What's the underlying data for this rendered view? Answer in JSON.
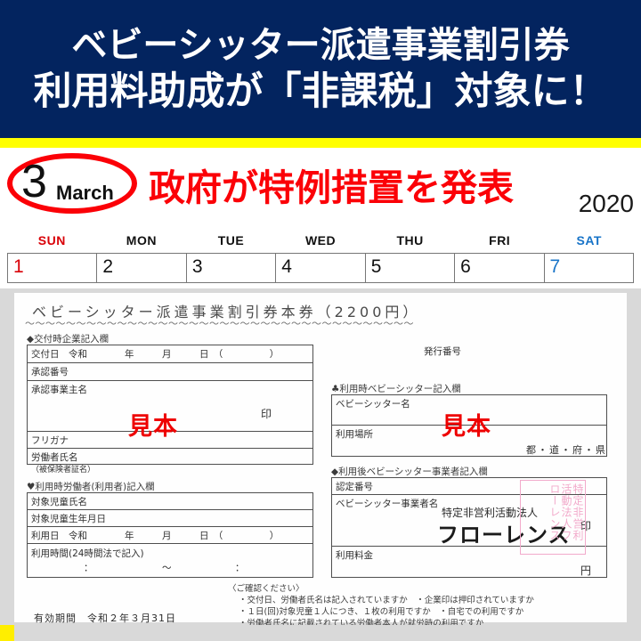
{
  "banner": {
    "line1": "ベビーシッター派遣事業割引券",
    "line2": "利用料助成が「非課税」対象に！",
    "bg_color": "#03245f",
    "text_color": "#ffffff",
    "accent_bar_color": "#ffff00"
  },
  "calendar": {
    "month_number": "3",
    "month_name": "March",
    "headline": "政府が特例措置を発表",
    "headline_color": "#fb0007",
    "year": "2020",
    "circle_color": "#fb0007",
    "weekdays": [
      "SUN",
      "MON",
      "TUE",
      "WED",
      "THU",
      "FRI",
      "SAT"
    ],
    "days": [
      "1",
      "2",
      "3",
      "4",
      "5",
      "6",
      "7"
    ],
    "sunday_color": "#d90007",
    "saturday_color": "#1874c8"
  },
  "coupon": {
    "title": "ベビーシッター派遣事業割引券本券（2200円）",
    "issue_number_label": "発行番号",
    "watermark": "見本",
    "watermark_color": "#ee0000",
    "section_company": {
      "label": "◆交付時企業記入欄",
      "row_issue_date": "交付日　令和　　　　年　　　月　　　日　（　　　　　）",
      "row_approval_number": "承認番号",
      "row_employer_name": "承認事業主名",
      "seal_mark": "印",
      "row_furigana": "フリガナ",
      "row_worker_name": "労働者氏名",
      "row_worker_name_sub": "（被保険者証名）"
    },
    "section_worker": {
      "label": "♥利用時労働者(利用者)記入欄",
      "row_child_name": "対象児童氏名",
      "row_child_birth": "対象児童生年月日",
      "row_use_date": "利用日　令和　　　　年　　　月　　　日　（　　　　　）",
      "row_use_time": "利用時間(24時間法で記入)",
      "time_from": "：",
      "time_sep": "～",
      "time_to": "："
    },
    "section_sitter": {
      "label": "♣利用時ベビーシッター記入欄",
      "row_sitter_name": "ベビーシッター名",
      "row_place": "利用場所",
      "prefecture": "都・道・府・県"
    },
    "section_provider": {
      "label": "◆利用後ベビーシッター事業者記入欄",
      "row_cert_number": "認定番号",
      "row_provider_name": "ベビーシッター事業者名",
      "org_prefix": "特定非営利活動法人",
      "org_name": "フローレンス",
      "seal_mark": "印",
      "stamp_text": "特定非営利活動法人フローレンス",
      "stamp_color": "#f2aacb",
      "row_fee": "利用料金",
      "fee_unit": "円"
    },
    "confirm": {
      "title": "〈ご確認ください〉",
      "line1": "・交付日、労働者氏名は記入されていますか　・企業印は押印されていますか",
      "line2": "・１日(回)対象児童１人につき、１枚の利用ですか　・自宅での利用ですか",
      "line3": "・労働者氏名に記載されている労働者本人が就労時の利用ですか"
    },
    "validity": "有効期間　令和２年３月31日"
  }
}
